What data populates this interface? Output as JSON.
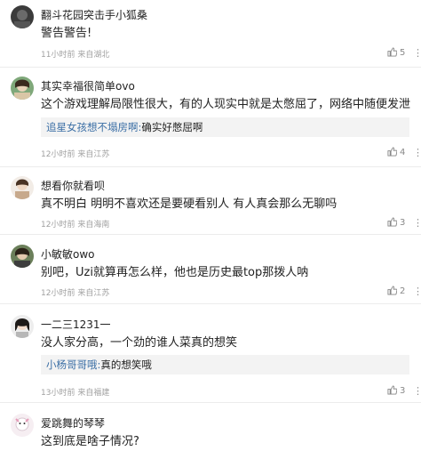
{
  "comments": [
    {
      "username": "翻斗花园突击手小狐桑",
      "content": "警告警告!",
      "meta": "11小时前 来自湖北",
      "likes": "5",
      "more": "⋮"
    },
    {
      "username": "其实幸福很简单ovo",
      "content": "这个游戏理解局限性很大，有的人现实中就是太憋屈了，网络中随便发泄",
      "reply_user": "追星女孩想不塌房啊:",
      "reply_text": "确实好憋屈啊",
      "meta": "12小时前 来自江苏",
      "likes": "4",
      "more": "⋮"
    },
    {
      "username": "想看你就看呗",
      "content": "真不明白 明明不喜欢还是要硬看别人 有人真会那么无聊吗",
      "meta": "12小时前 来自海南",
      "likes": "3",
      "more": "⋮"
    },
    {
      "username": "小敏敏owo",
      "content": "别吧，Uzi就算再怎么样，他也是历史最top那拨人呐",
      "meta": "12小时前 来自江苏",
      "likes": "2",
      "more": "⋮"
    },
    {
      "username": "一二三1231一",
      "content": "没人家分高，一个劲的谁人菜真的想笑",
      "reply_user": "小杨哥哥哦:",
      "reply_text": "真的想笑哦",
      "meta": "13小时前 来自福建",
      "likes": "3",
      "more": "⋮"
    },
    {
      "username": "爱跳舞的琴琴",
      "content": "这到底是啥子情况?"
    }
  ]
}
